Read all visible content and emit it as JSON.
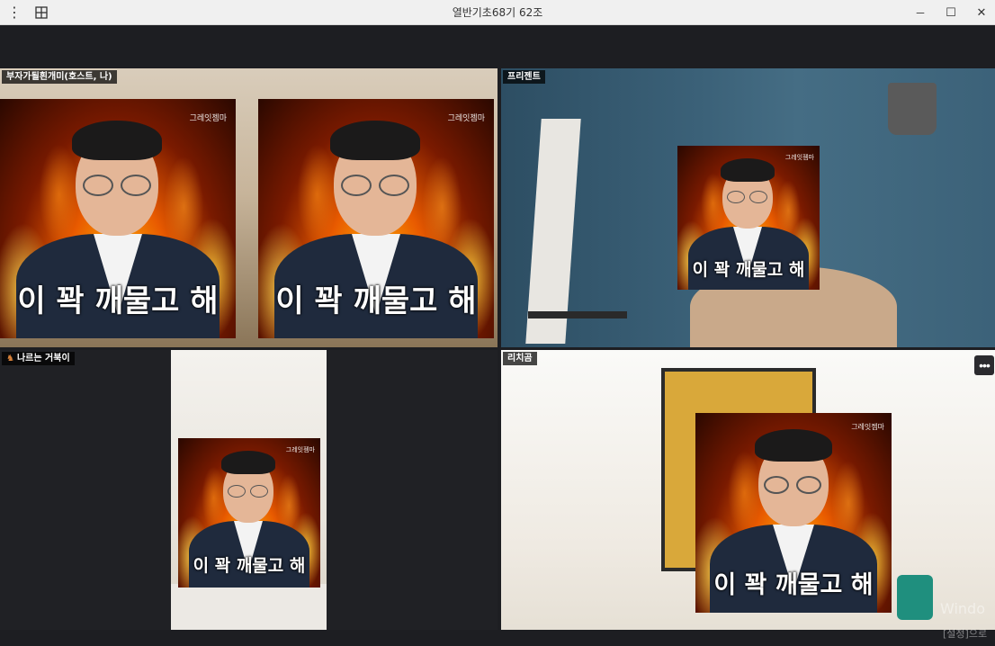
{
  "window": {
    "title": "열반기초68기 62조",
    "menu_icon": "kebab-icon",
    "layout_icon": "grid-icon",
    "controls": {
      "minimize": "─",
      "maximize": "☐",
      "close": "✕"
    }
  },
  "participants": [
    {
      "name": "부자가될흰개미(호스트, 나)"
    },
    {
      "name": "프리젠트"
    },
    {
      "name": "나르는 거북이"
    },
    {
      "name": "리치곰"
    }
  ],
  "video": {
    "watermark": "그레잇젬마",
    "caption": "이 꽉 깨물고 해"
  },
  "overlay": {
    "windows_line1": "Windo",
    "windows_line2": "[설정]으로"
  },
  "accent_color": "#19c2a0"
}
